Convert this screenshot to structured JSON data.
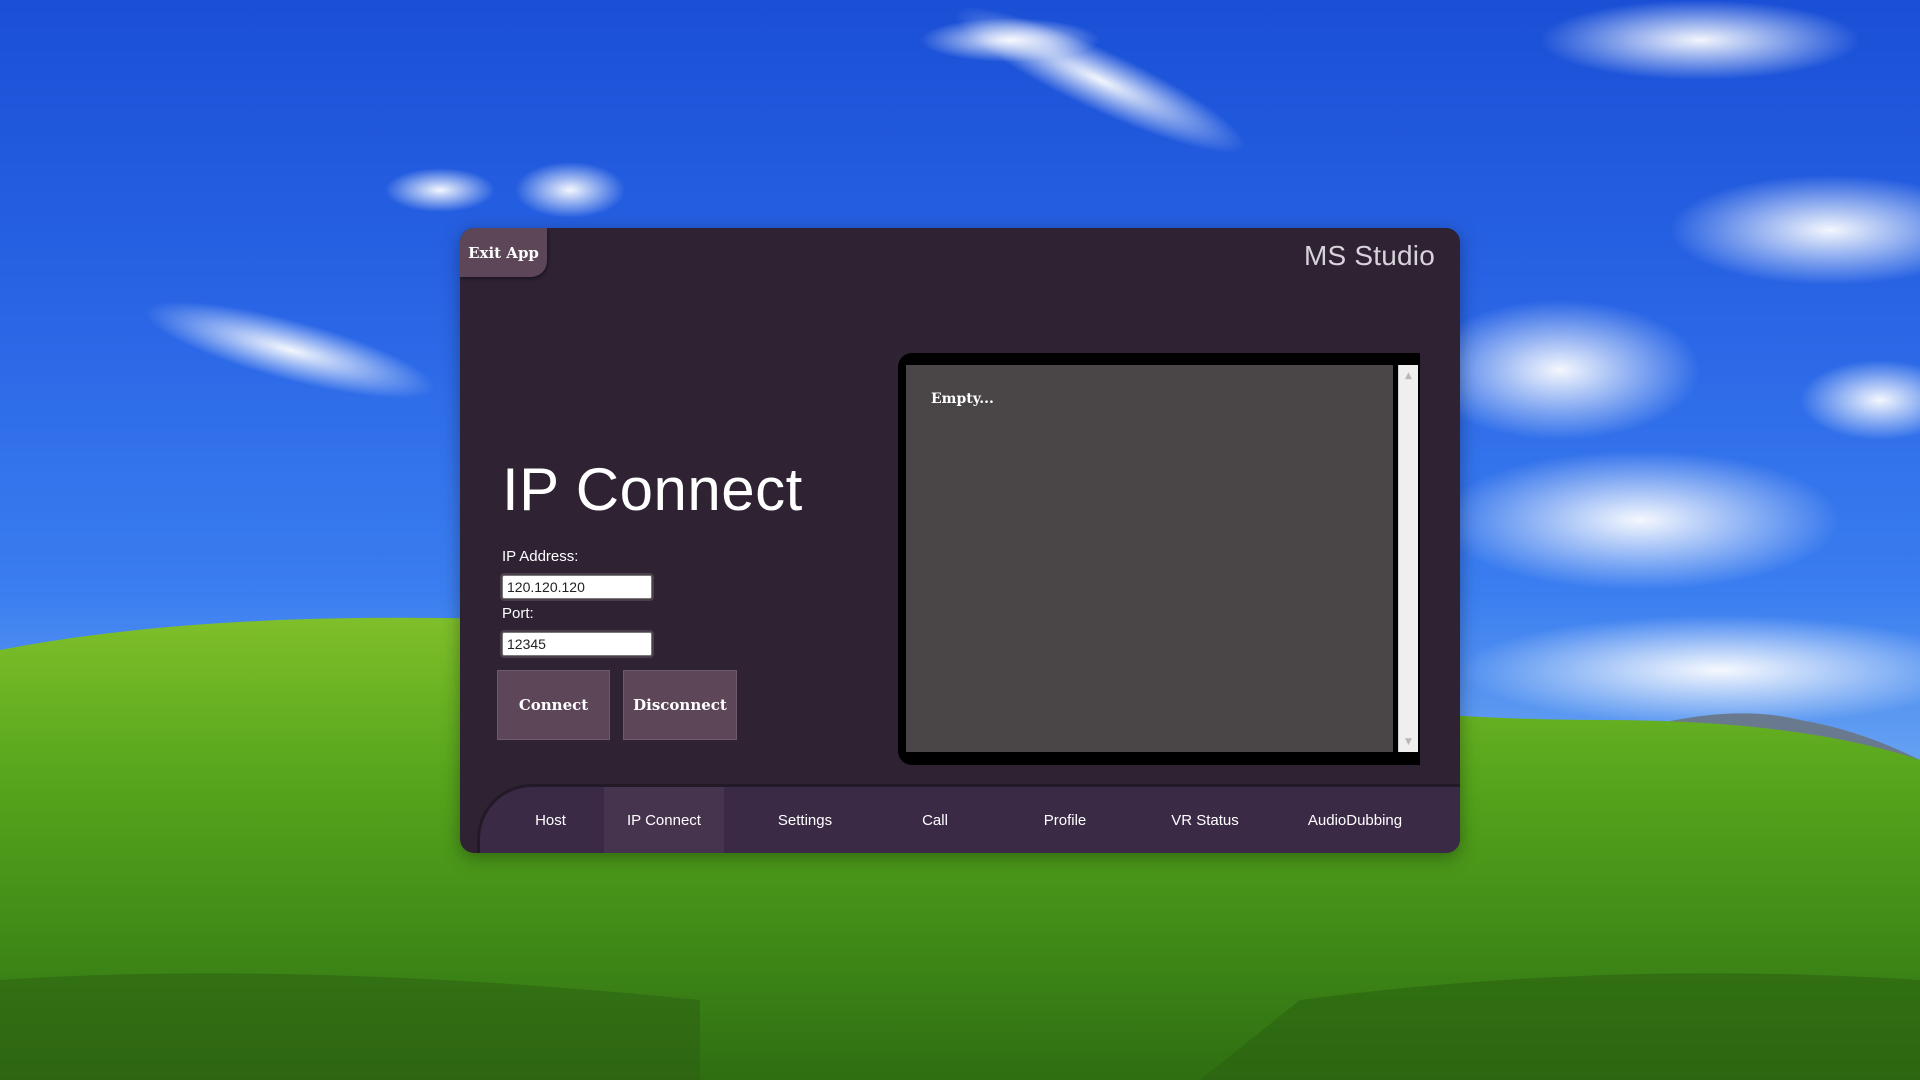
{
  "app": {
    "exit_label": "Exit App",
    "title": "MS Studio"
  },
  "page": {
    "heading": "IP Connect",
    "ip_label": "IP Address:",
    "ip_value": "120.120.120",
    "port_label": "Port:",
    "port_value": "12345",
    "connect_label": "Connect",
    "disconnect_label": "Disconnect"
  },
  "log": {
    "text": "Empty..."
  },
  "nav": {
    "tabs": [
      {
        "label": "Host"
      },
      {
        "label": "IP Connect"
      },
      {
        "label": "Settings"
      },
      {
        "label": "Call"
      },
      {
        "label": "Profile"
      },
      {
        "label": "VR Status"
      },
      {
        "label": "AudioDubbing"
      }
    ],
    "active_tab": "IP Connect"
  },
  "colors": {
    "window_bg": "#2e2233",
    "button_bg": "#5c4657",
    "nav_bg": "#3b2a46",
    "log_bg": "#4a4546"
  }
}
